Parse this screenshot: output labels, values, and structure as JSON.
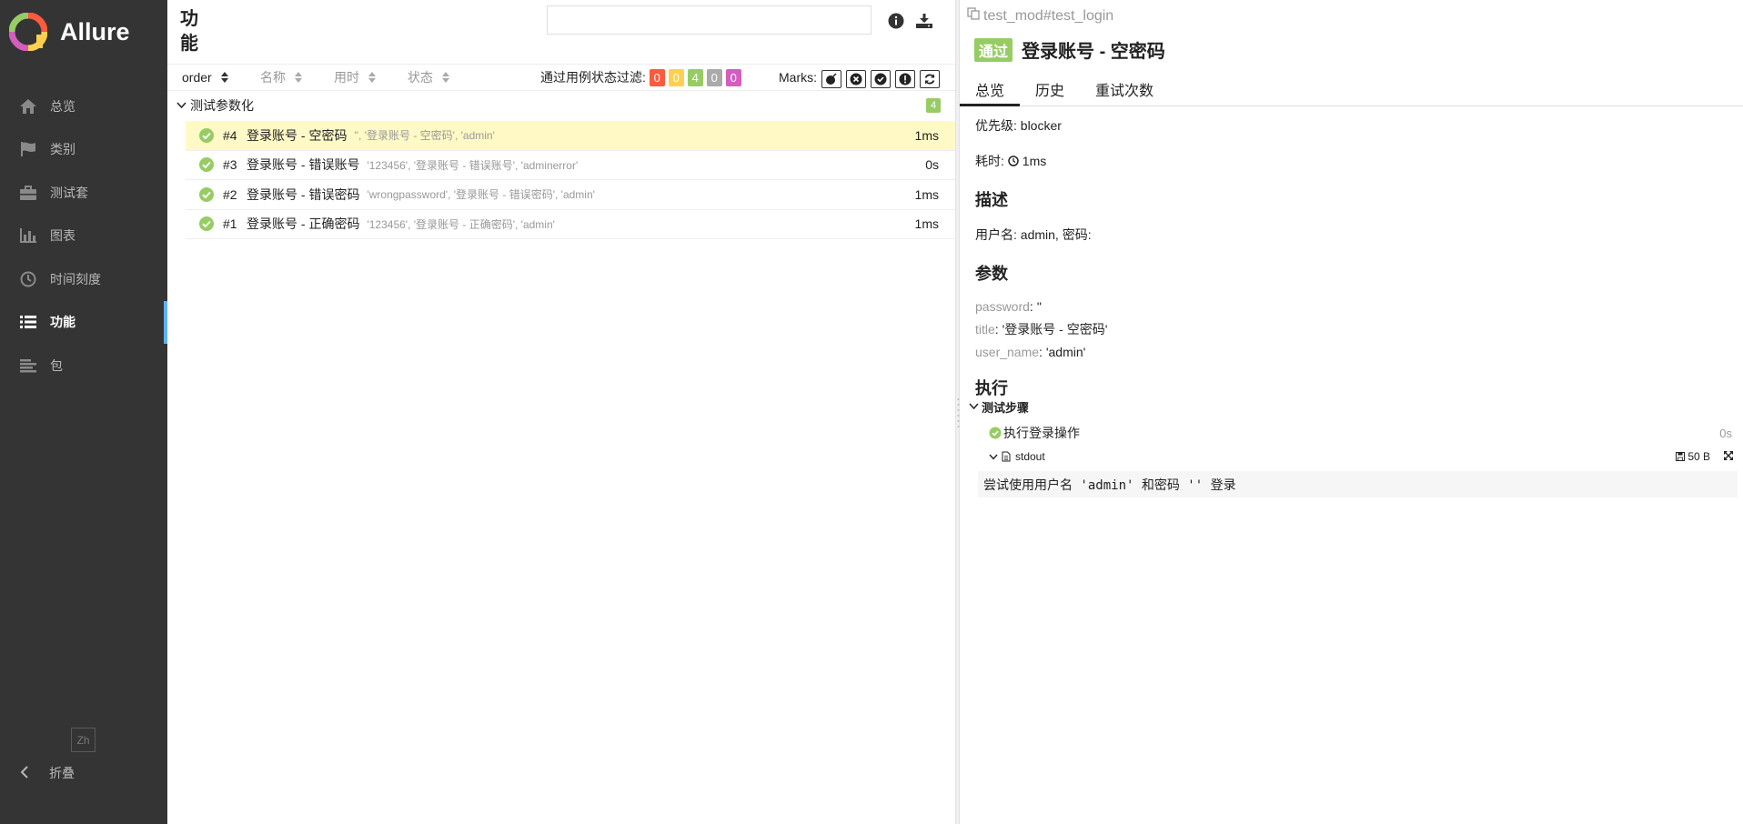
{
  "brand": {
    "name": "Allure"
  },
  "sidebar": {
    "items": [
      {
        "label": "总览",
        "icon": "home-icon"
      },
      {
        "label": "类别",
        "icon": "flag-icon"
      },
      {
        "label": "测试套",
        "icon": "briefcase-icon"
      },
      {
        "label": "图表",
        "icon": "bar-chart-icon"
      },
      {
        "label": "时间刻度",
        "icon": "clock-icon"
      },
      {
        "label": "功能",
        "icon": "list-icon",
        "active": true
      },
      {
        "label": "包",
        "icon": "align-left-icon"
      }
    ],
    "language": "Zh",
    "collapse_label": "折叠"
  },
  "mid": {
    "title": "功能",
    "search": {
      "value": "",
      "placeholder": ""
    },
    "sort_columns": [
      "order",
      "名称",
      "用时",
      "状态"
    ],
    "filter_label": "通过用例状态过滤:",
    "status_counts": [
      {
        "value": "0",
        "color": "#fd5a3e"
      },
      {
        "value": "0",
        "color": "#ffd050"
      },
      {
        "value": "4",
        "color": "#97cc64"
      },
      {
        "value": "0",
        "color": "#aaaaaa"
      },
      {
        "value": "0",
        "color": "#d35ebe"
      }
    ],
    "marks_label": "Marks:",
    "group": {
      "name": "测试参数化",
      "count": "4",
      "rows": [
        {
          "num": "#4",
          "name": "登录账号 - 空密码",
          "params": "'', '登录账号 - 空密码', 'admin'",
          "duration": "1ms",
          "selected": true
        },
        {
          "num": "#3",
          "name": "登录账号 - 错误账号",
          "params": "'123456', '登录账号 - 错误账号', 'adminerror'",
          "duration": "0s"
        },
        {
          "num": "#2",
          "name": "登录账号 - 错误密码",
          "params": "'wrongpassword', '登录账号 - 错误密码', 'admin'",
          "duration": "1ms"
        },
        {
          "num": "#1",
          "name": "登录账号 - 正确密码",
          "params": "'123456', '登录账号 - 正确密码', 'admin'",
          "duration": "1ms"
        }
      ]
    }
  },
  "detail": {
    "breadcrumb": "test_mod#test_login",
    "status": "通过",
    "title": "登录账号 - 空密码",
    "tabs": [
      "总览",
      "历史",
      "重试次数"
    ],
    "severity_label": "优先级:",
    "severity": "blocker",
    "duration_label": "耗时:",
    "duration": "1ms",
    "description_title": "描述",
    "description": "用户名: admin, 密码:",
    "params_title": "参数",
    "params": [
      {
        "key": "password",
        "value": "''"
      },
      {
        "key": "title",
        "value": "'登录账号 - 空密码'"
      },
      {
        "key": "user_name",
        "value": "'admin'"
      }
    ],
    "execution_title": "执行",
    "steps_title": "测试步骤",
    "step": {
      "name": "执行登录操作",
      "duration": "0s"
    },
    "attachment": {
      "name": "stdout",
      "size": "50 B"
    },
    "stdout_text": "尝试使用用户名 'admin' 和密码 '' 登录"
  }
}
